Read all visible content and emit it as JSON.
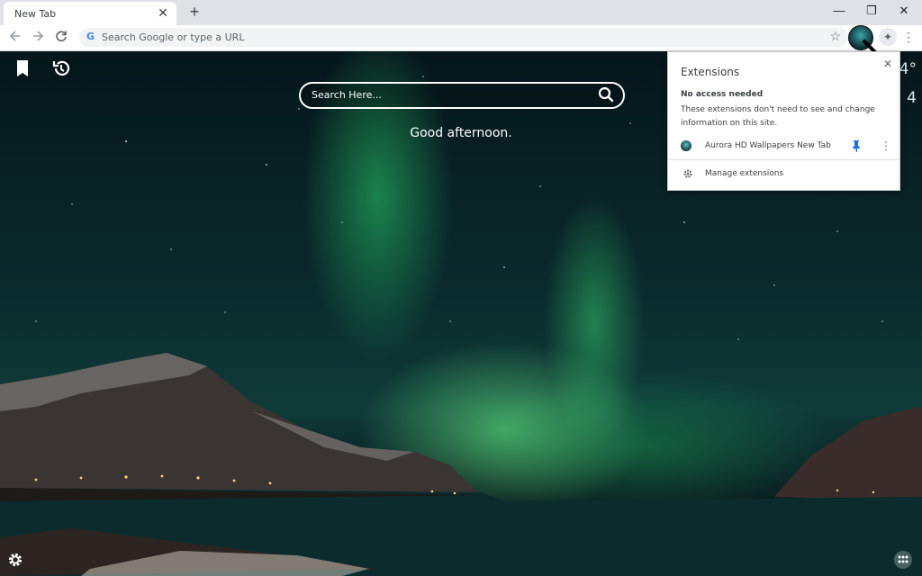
{
  "tab": {
    "title": "New Tab",
    "close_icon": "close-icon"
  },
  "toolbar": {
    "omnibox_placeholder": "Search Google or type a URL",
    "omnibox_icon": "google-g-icon",
    "bookmark_star_icon": "star-outline-icon"
  },
  "window_controls": {
    "minimize": "—",
    "restore": "❐",
    "close": "✕"
  },
  "newtab_page": {
    "search_placeholder": "Search Here...",
    "greeting": "Good afternoon.",
    "weather_temp_fragment": "4°",
    "weather_line2_fragment": "4",
    "icons": [
      "bookmark-icon",
      "history-icon",
      "settings-gear-icon",
      "apps-grid-icon"
    ]
  },
  "extensions_popup": {
    "title": "Extensions",
    "section_title": "No access needed",
    "section_desc": "These extensions don't need to see and change information on this site.",
    "extension_name": "Aurora HD Wallpapers New Tab",
    "manage_label": "Manage extensions",
    "pin_color": "#1a73e8"
  },
  "colors": {
    "tabstrip": "#dee1e6",
    "aurora_green": "#2ee67a",
    "chrome_text": "#3c4043"
  }
}
